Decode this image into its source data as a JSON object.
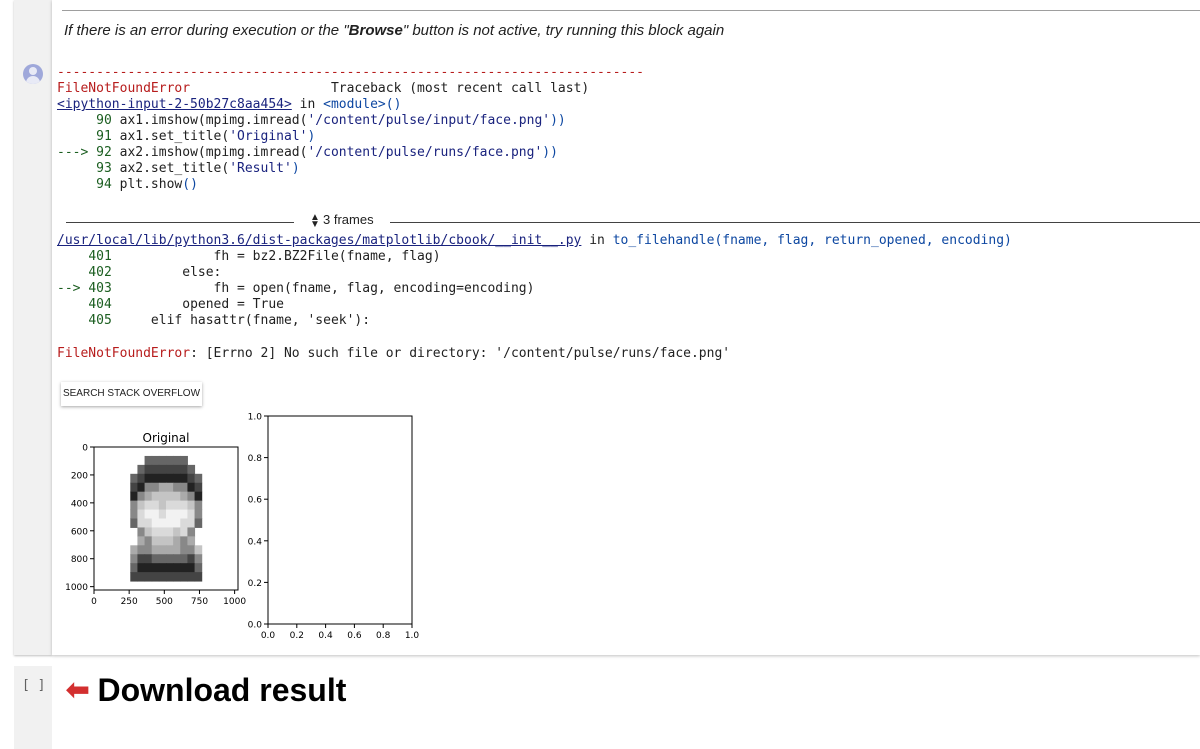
{
  "cell1": {
    "note_pre": "If there is an error during execution or the \"",
    "note_bold": "Browse",
    "note_post": "\" button is not active, try running this block again"
  },
  "output": {
    "separator": "---------------------------------------------------------------------------",
    "error_name": "FileNotFoundError",
    "traceback_label": "Traceback (most recent call last)",
    "input_link": "<ipython-input-2-50b27c8aa454>",
    "in_word": " in ",
    "module": "<module>",
    "module_parens": "()",
    "code_lines_1": [
      {
        "prefix": "     ",
        "num": "90",
        "code": " ax1.imshow(mpimg.imread(",
        "str": "'/content/pulse/input/face.png'",
        "end": "))"
      },
      {
        "prefix": "     ",
        "num": "91",
        "code": " ax1.set_title(",
        "str": "'Original'",
        "end": ")"
      },
      {
        "prefix": "---> ",
        "num": "92",
        "code": " ax2.imshow(mpimg.imread(",
        "str": "'/content/pulse/runs/face.png'",
        "end": "))"
      },
      {
        "prefix": "     ",
        "num": "93",
        "code": " ax2.set_title(",
        "str": "'Result'",
        "end": ")"
      },
      {
        "prefix": "     ",
        "num": "94",
        "code": " plt.show",
        "str": "",
        "end": "()"
      }
    ],
    "frames_label": "3 frames",
    "file_link": "/usr/local/lib/python3.6/dist-packages/matplotlib/cbook/__init__.py",
    "file_in": " in ",
    "func_name": "to_filehandle",
    "func_args": "(fname, flag, return_opened, encoding)",
    "code_lines_2": [
      {
        "prefix": "    ",
        "num": "401",
        "code": "             fh = bz2.BZ2File(fname, flag)"
      },
      {
        "prefix": "    ",
        "num": "402",
        "code": "         else:"
      },
      {
        "prefix": "--> ",
        "num": "403",
        "code": "             fh = open(fname, flag, encoding=encoding)"
      },
      {
        "prefix": "    ",
        "num": "404",
        "code": "         opened = True"
      },
      {
        "prefix": "    ",
        "num": "405",
        "code": "     elif hasattr(fname, 'seek'):"
      }
    ],
    "final_error_name": "FileNotFoundError",
    "final_error_msg": ": [Errno 2] No such file or directory: '/content/pulse/runs/face.png'",
    "so_button": "SEARCH STACK OVERFLOW"
  },
  "plot": {
    "left_title": "Original",
    "left_yticks": [
      "0",
      "200",
      "400",
      "600",
      "800",
      "1000"
    ],
    "left_xticks": [
      "0",
      "250",
      "500",
      "750",
      "1000"
    ],
    "right_yticks": [
      "0.0",
      "0.2",
      "0.4",
      "0.6",
      "0.8",
      "1.0"
    ],
    "right_xticks": [
      "0.0",
      "0.2",
      "0.4",
      "0.6",
      "0.8",
      "1.0"
    ]
  },
  "cell2": {
    "bracket": "[ ]",
    "arrow": "⬅",
    "heading": "Download result"
  }
}
